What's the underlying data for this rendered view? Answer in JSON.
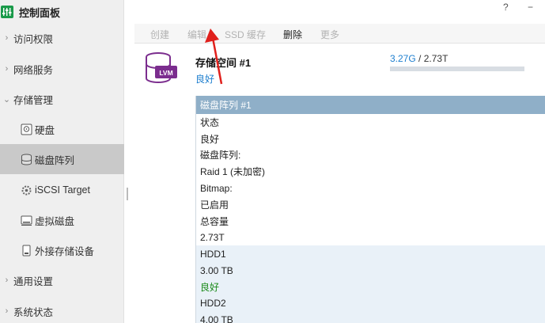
{
  "app": {
    "title": "控制面板"
  },
  "window": {
    "help": "?",
    "minimize": "−"
  },
  "sidebar": {
    "items": [
      {
        "label": "访问权限",
        "chevron": "›"
      },
      {
        "label": "网络服务",
        "chevron": "›"
      },
      {
        "label": "存储管理",
        "chevron": "⌄"
      },
      {
        "label": "通用设置",
        "chevron": "›"
      },
      {
        "label": "系统状态",
        "chevron": "›"
      }
    ],
    "sub": [
      {
        "label": "硬盘",
        "icon": "disk-icon"
      },
      {
        "label": "磁盘阵列",
        "icon": "raid-icon"
      },
      {
        "label": "iSCSI Target",
        "icon": "iscsi-icon"
      },
      {
        "label": "虚拟磁盘",
        "icon": "virtual-disk-icon"
      },
      {
        "label": "外接存储设备",
        "icon": "external-storage-icon"
      }
    ]
  },
  "toolbar": {
    "create": "创建",
    "edit": "编辑",
    "ssd_cache": "SSD 缓存",
    "delete": "删除",
    "more": "更多"
  },
  "pool": {
    "name": "存储空间 #1",
    "status": "良好",
    "icon_text": "LVM",
    "used": "3.27G",
    "separator": " / ",
    "total": "2.73T",
    "usage_fraction": 0.0
  },
  "panel": {
    "header": "磁盘阵列 #1",
    "rows": [
      {
        "label": "状态"
      },
      {
        "label": "良好"
      },
      {
        "label": "磁盘阵列:"
      },
      {
        "label": "Raid 1 (未加密)"
      },
      {
        "label": "Bitmap:"
      },
      {
        "label": "已启用"
      },
      {
        "label": "总容量"
      },
      {
        "label": "2.73T"
      }
    ],
    "disks": [
      {
        "label": "HDD1"
      },
      {
        "label": "3.00 TB"
      },
      {
        "label": "良好"
      },
      {
        "label": "HDD2"
      },
      {
        "label": "4.00 TB"
      }
    ]
  },
  "colors": {
    "accent": "#1e7fcf",
    "panel_header": "#8fafc8",
    "good": "#1a8a1a",
    "arrow": "#e0201c",
    "icon_purple": "#7b2d8e"
  }
}
